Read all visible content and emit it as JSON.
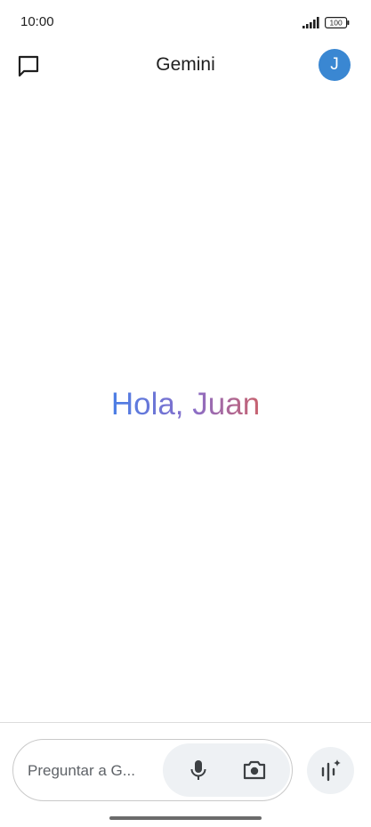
{
  "status_bar": {
    "time": "10:00",
    "battery": "100",
    "icons": [
      "signal-icon",
      "battery-icon"
    ]
  },
  "app_bar": {
    "title": "Gemini",
    "avatar_initial": "J",
    "icons": [
      "chat-icon"
    ],
    "avatar_color": "#3a87d2"
  },
  "greeting": {
    "text": "Hola, Juan",
    "gradient_colors": [
      "#4b7fe6",
      "#8a6ec9",
      "#c8626e"
    ]
  },
  "prompt": {
    "placeholder": "Preguntar a G...",
    "value": "",
    "icons": [
      "microphone-icon",
      "camera-icon",
      "live-waveform-sparkle-icon"
    ]
  },
  "colors": {
    "background": "#ffffff",
    "text": "#1f1f1f",
    "muted_text": "#5f6368",
    "tool_background": "#eef1f4"
  }
}
